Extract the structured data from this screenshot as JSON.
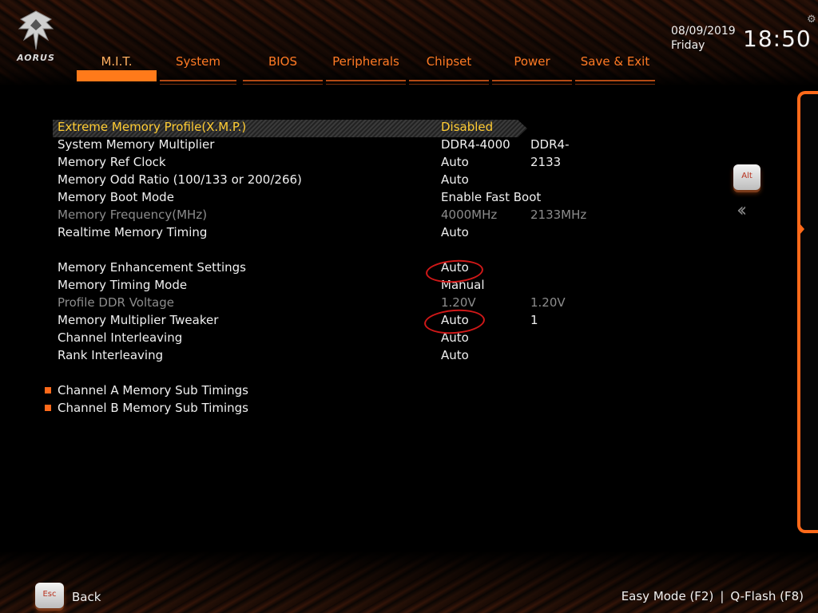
{
  "brand": {
    "logo_text": "AORUS"
  },
  "header": {
    "tabs": [
      {
        "label": "M.I.T.",
        "active": true
      },
      {
        "label": "System",
        "active": false
      },
      {
        "label": "BIOS",
        "active": false
      },
      {
        "label": "Peripherals",
        "active": false
      },
      {
        "label": "Chipset",
        "active": false
      },
      {
        "label": "Power",
        "active": false
      },
      {
        "label": "Save & Exit",
        "active": false
      }
    ],
    "date": "08/09/2019",
    "day": "Friday",
    "time": "18:50",
    "settings_icon": "gear-icon"
  },
  "settings": [
    {
      "label": "Extreme Memory Profile(X.M.P.)",
      "value": "Disabled",
      "value2": "",
      "state": "selected"
    },
    {
      "label": "System Memory Multiplier",
      "value": "DDR4-4000",
      "value2": "DDR4-2133",
      "state": "normal"
    },
    {
      "label": "Memory Ref Clock",
      "value": "Auto",
      "value2": "",
      "state": "normal"
    },
    {
      "label": "Memory Odd Ratio (100/133 or 200/266)",
      "value": "Auto",
      "value2": "",
      "state": "normal"
    },
    {
      "label": "Memory Boot Mode",
      "value": "Enable Fast Boot",
      "value2": "",
      "state": "normal"
    },
    {
      "label": "Memory Frequency(MHz)",
      "value": "4000MHz",
      "value2": "2133MHz",
      "state": "disabled"
    },
    {
      "label": "Realtime Memory Timing",
      "value": "Auto",
      "value2": "",
      "state": "normal"
    },
    {
      "label": "Memory Enhancement Settings",
      "value": "Auto",
      "value2": "",
      "state": "normal"
    },
    {
      "label": "Memory Timing Mode",
      "value": "Manual",
      "value2": "",
      "state": "normal"
    },
    {
      "label": "Profile DDR Voltage",
      "value": "1.20V",
      "value2": "1.20V",
      "state": "disabled"
    },
    {
      "label": "Memory Multiplier Tweaker",
      "value": "Auto",
      "value2": "1",
      "state": "normal"
    },
    {
      "label": "Channel Interleaving",
      "value": "Auto",
      "value2": "",
      "state": "normal"
    },
    {
      "label": "Rank Interleaving",
      "value": "Auto",
      "value2": "",
      "state": "normal"
    }
  ],
  "submenus": [
    {
      "label": "Channel A Memory Sub Timings"
    },
    {
      "label": "Channel B Memory Sub Timings"
    }
  ],
  "side": {
    "alt_label": "Alt",
    "collapse_icon": "double-chevron-left-icon"
  },
  "footer": {
    "esc_label": "Esc",
    "back_label": "Back",
    "easy_mode": "Easy Mode (F2)",
    "separator": "|",
    "qflash": "Q-Flash (F8)"
  },
  "colors": {
    "accent": "#ff6a1a",
    "tab_text": "#ff7a24",
    "selected_text": "#ffcc33",
    "disabled_text": "#8c8c8c",
    "annotation": "#d01818"
  }
}
